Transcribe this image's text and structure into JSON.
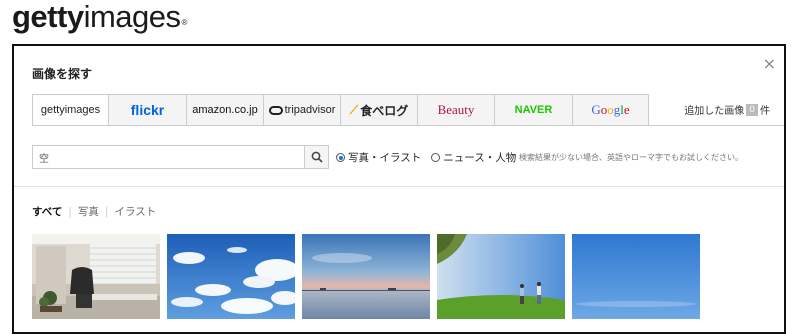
{
  "brand": {
    "logo_bold": "getty",
    "logo_regular": "images",
    "registered": "®"
  },
  "dialog": {
    "title": "画像を探す",
    "close_glyph": "×",
    "tabs": [
      {
        "label": "gettyimages"
      },
      {
        "label": "flickr"
      },
      {
        "label": "amazon.co.jp"
      },
      {
        "label": "tripadvisor"
      },
      {
        "label": "食べログ"
      },
      {
        "label": "Beauty"
      },
      {
        "label": "NAVER"
      },
      {
        "label": "Google"
      }
    ],
    "added": {
      "prefix": "追加した画像",
      "count": "0",
      "suffix": "件"
    },
    "search": {
      "value": "空",
      "placeholder": "",
      "icon": "magnifier-icon"
    },
    "radios": [
      {
        "label": "写真・イラスト",
        "selected": true
      },
      {
        "label": "ニュース・人物",
        "selected": false
      }
    ],
    "hint": "検索結果が少ない場合、英語やローマ字でもお試しください。",
    "filters": [
      {
        "label": "すべて",
        "active": true
      },
      {
        "label": "写真",
        "active": false
      },
      {
        "label": "イラスト",
        "active": false
      }
    ]
  },
  "colors": {
    "flickr_blue": "#0063dc",
    "naver_green": "#1ec800",
    "beauty_red": "#b0124a",
    "radio_blue": "#1a6fd6"
  }
}
